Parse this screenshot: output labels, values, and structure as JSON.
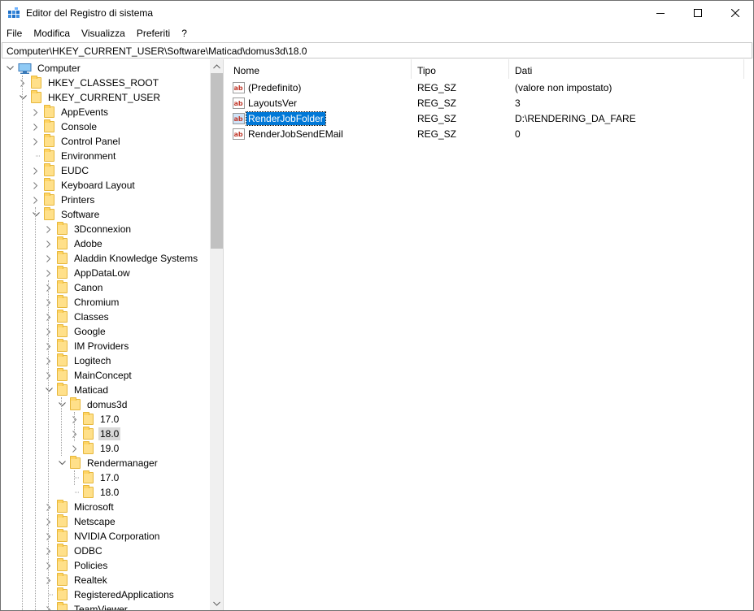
{
  "window": {
    "title": "Editor del Registro di sistema"
  },
  "menu": [
    "File",
    "Modifica",
    "Visualizza",
    "Preferiti",
    "?"
  ],
  "address": "Computer\\HKEY_CURRENT_USER\\Software\\Maticad\\domus3d\\18.0",
  "tree": {
    "root": "Computer",
    "nodes": [
      {
        "label": "HKEY_CLASSES_ROOT",
        "level": 1,
        "state": "collapsed"
      },
      {
        "label": "HKEY_CURRENT_USER",
        "level": 1,
        "state": "expanded"
      },
      {
        "label": "AppEvents",
        "level": 2,
        "state": "collapsed"
      },
      {
        "label": "Console",
        "level": 2,
        "state": "collapsed"
      },
      {
        "label": "Control Panel",
        "level": 2,
        "state": "collapsed"
      },
      {
        "label": "Environment",
        "level": 2,
        "state": "leaf"
      },
      {
        "label": "EUDC",
        "level": 2,
        "state": "collapsed"
      },
      {
        "label": "Keyboard Layout",
        "level": 2,
        "state": "collapsed"
      },
      {
        "label": "Printers",
        "level": 2,
        "state": "collapsed"
      },
      {
        "label": "Software",
        "level": 2,
        "state": "expanded"
      },
      {
        "label": "3Dconnexion",
        "level": 3,
        "state": "collapsed"
      },
      {
        "label": "Adobe",
        "level": 3,
        "state": "collapsed"
      },
      {
        "label": "Aladdin Knowledge Systems",
        "level": 3,
        "state": "collapsed"
      },
      {
        "label": "AppDataLow",
        "level": 3,
        "state": "collapsed"
      },
      {
        "label": "Canon",
        "level": 3,
        "state": "collapsed"
      },
      {
        "label": "Chromium",
        "level": 3,
        "state": "collapsed"
      },
      {
        "label": "Classes",
        "level": 3,
        "state": "collapsed"
      },
      {
        "label": "Google",
        "level": 3,
        "state": "collapsed"
      },
      {
        "label": "IM Providers",
        "level": 3,
        "state": "collapsed"
      },
      {
        "label": "Logitech",
        "level": 3,
        "state": "collapsed"
      },
      {
        "label": "MainConcept",
        "level": 3,
        "state": "collapsed"
      },
      {
        "label": "Maticad",
        "level": 3,
        "state": "expanded"
      },
      {
        "label": "domus3d",
        "level": 4,
        "state": "expanded"
      },
      {
        "label": "17.0",
        "level": 5,
        "state": "collapsed"
      },
      {
        "label": "18.0",
        "level": 5,
        "state": "collapsed",
        "selected": true
      },
      {
        "label": "19.0",
        "level": 5,
        "state": "collapsed"
      },
      {
        "label": "Rendermanager",
        "level": 4,
        "state": "expanded"
      },
      {
        "label": "17.0",
        "level": 5,
        "state": "leaf"
      },
      {
        "label": "18.0",
        "level": 5,
        "state": "leaf"
      },
      {
        "label": "Microsoft",
        "level": 3,
        "state": "collapsed"
      },
      {
        "label": "Netscape",
        "level": 3,
        "state": "collapsed"
      },
      {
        "label": "NVIDIA Corporation",
        "level": 3,
        "state": "collapsed"
      },
      {
        "label": "ODBC",
        "level": 3,
        "state": "collapsed"
      },
      {
        "label": "Policies",
        "level": 3,
        "state": "collapsed"
      },
      {
        "label": "Realtek",
        "level": 3,
        "state": "collapsed"
      },
      {
        "label": "RegisteredApplications",
        "level": 3,
        "state": "leaf"
      },
      {
        "label": "TeamViewer",
        "level": 3,
        "state": "collapsed"
      }
    ]
  },
  "columns": {
    "name": "Nome",
    "type": "Tipo",
    "data": "Dati"
  },
  "values": [
    {
      "name": "(Predefinito)",
      "type": "REG_SZ",
      "data": "(valore non impostato)"
    },
    {
      "name": "LayoutsVer",
      "type": "REG_SZ",
      "data": "3"
    },
    {
      "name": "RenderJobFolder",
      "type": "REG_SZ",
      "data": "D:\\RENDERING_DA_FARE",
      "selected": true
    },
    {
      "name": "RenderJobSendEMail",
      "type": "REG_SZ",
      "data": "0"
    }
  ],
  "colors": {
    "selection": "#0078d7",
    "folder": "#ffe08a",
    "tree_selection": "#d9d9d9"
  }
}
